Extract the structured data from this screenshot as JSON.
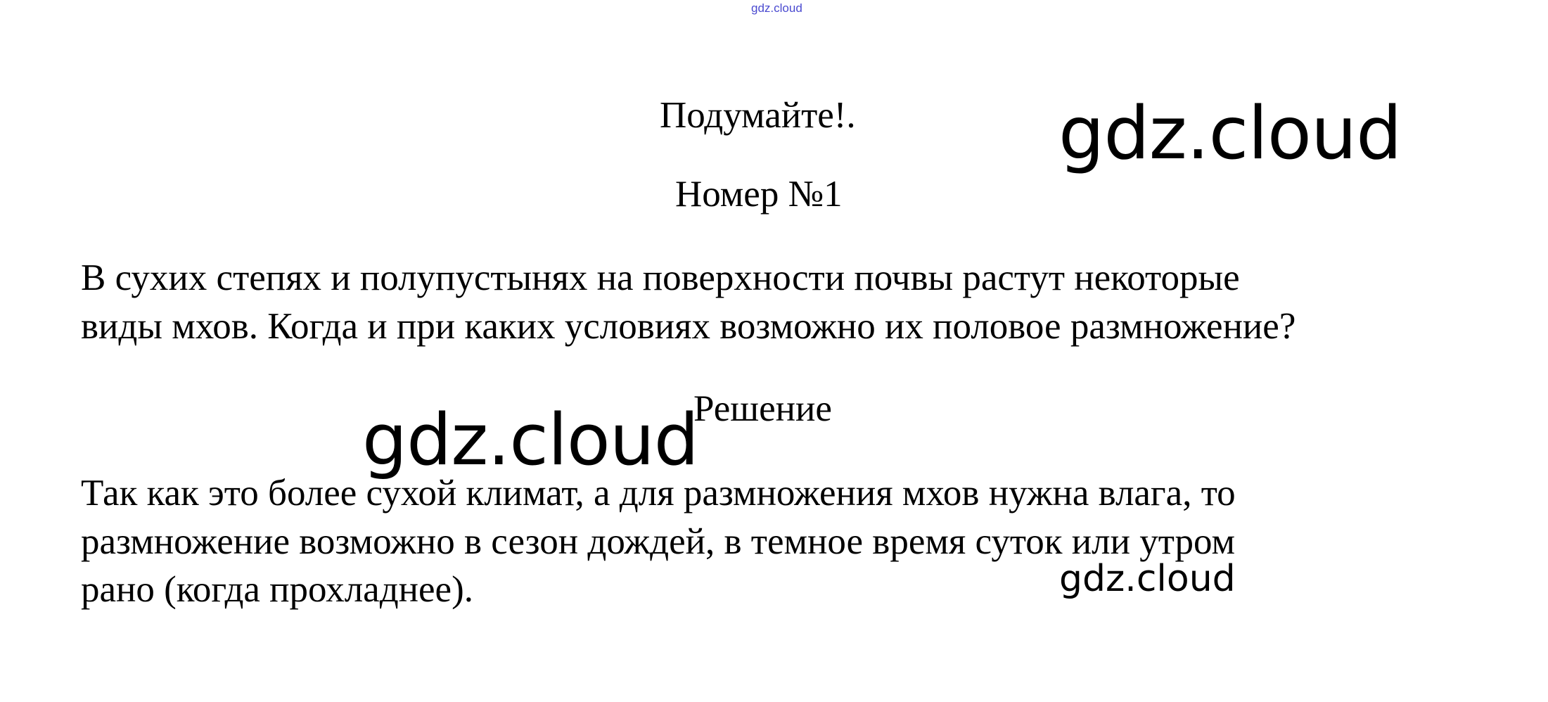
{
  "watermarks": {
    "top": "gdz.cloud",
    "right": "gdz.cloud",
    "middle": "gdz.cloud",
    "small": "gdz.cloud"
  },
  "heading": {
    "section": "Подумайте!.",
    "number": "Номер №1"
  },
  "question": {
    "lines": [
      "В сухих степях и полупустынях на поверхности почвы растут некоторые",
      "виды мхов. Когда и при каких условиях возможно их половое размножение?"
    ]
  },
  "solution": {
    "label": "Решение",
    "lines": [
      "Так как это более сухой климат, а для размножения мхов нужна влага, то",
      "размножение возможно в сезон дождей, в темное время суток или утром",
      "рано (когда прохладнее)."
    ]
  }
}
